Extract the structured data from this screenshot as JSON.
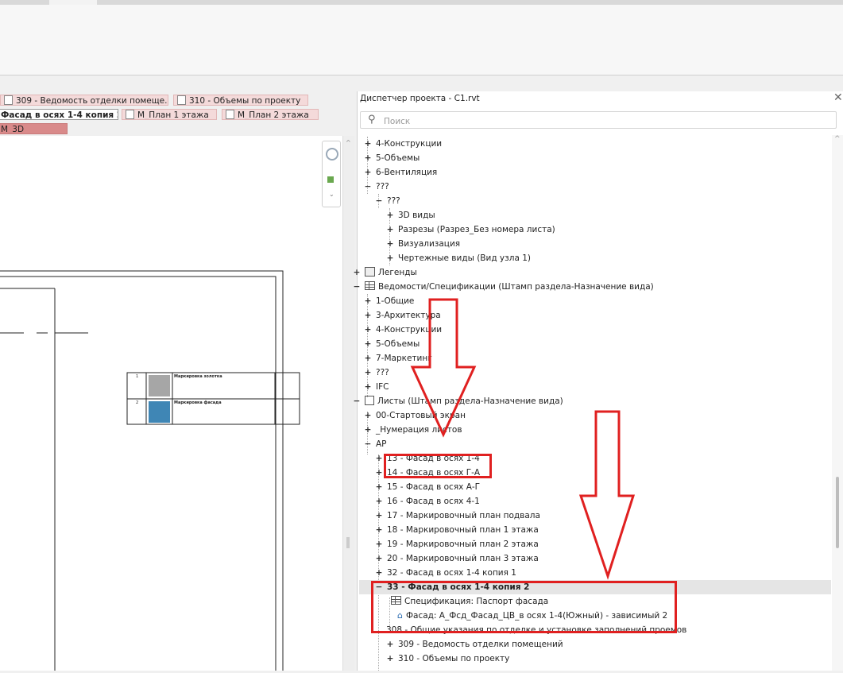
{
  "view_tabs": {
    "row1": [
      "309 - Ведомость отделки помеще...",
      "310 - Объемы по проекту"
    ],
    "row2_active": "Фасад в осях 1-4 копия 2",
    "row2": [
      "М_План 1 этажа",
      "М_План 2 этажа"
    ],
    "row3": "М_3D"
  },
  "canvas": {
    "legend_rows": [
      {
        "num": "1",
        "label": "Маркировка золотка"
      },
      {
        "num": "2",
        "label": "Маркировка фасада"
      }
    ],
    "swatch_colors": [
      "#a6a6a6",
      "#3f86b5"
    ]
  },
  "project_browser": {
    "title": "Диспетчер проекта - С1.rvt",
    "search_placeholder": "Поиск",
    "items": [
      {
        "pm": "+",
        "label": "4-Конструкции"
      },
      {
        "pm": "+",
        "label": "5-Объемы"
      },
      {
        "pm": "+",
        "label": "6-Вентиляция"
      },
      {
        "pm": "−",
        "label": "???"
      },
      {
        "pm": "−",
        "label": "???"
      },
      {
        "pm": "+",
        "label": "3D виды"
      },
      {
        "pm": "+",
        "label": "Разрезы (Разрез_Без номера листа)"
      },
      {
        "pm": "+",
        "label": "Визуализация"
      },
      {
        "pm": "+",
        "label": "Чертежные виды (Вид узла 1)"
      },
      {
        "pm": "+",
        "label": "Легенды"
      },
      {
        "pm": "−",
        "label": "Ведомости/Спецификации (Штамп раздела-Назначение вида)"
      },
      {
        "pm": "+",
        "label": "1-Общие"
      },
      {
        "pm": "+",
        "label": "3-Архитектура"
      },
      {
        "pm": "+",
        "label": "4-Конструкции"
      },
      {
        "pm": "+",
        "label": "5-Объемы"
      },
      {
        "pm": "+",
        "label": "7-Маркетинг"
      },
      {
        "pm": "+",
        "label": "???"
      },
      {
        "pm": "+",
        "label": "IFC"
      },
      {
        "pm": "−",
        "label": "Листы (Штамп раздела-Назначение вида)"
      },
      {
        "pm": "+",
        "label": "00-Стартовый экран"
      },
      {
        "pm": "+",
        "label": "_Нумерация листов"
      },
      {
        "pm": "−",
        "label": "АР"
      },
      {
        "pm": "+",
        "label": "13 - Фасад в осях 1-4"
      },
      {
        "pm": "+",
        "label": "14 - Фасад в осях Г-А"
      },
      {
        "pm": "+",
        "label": "15 - Фасад в осях А-Г"
      },
      {
        "pm": "+",
        "label": "16 - Фасад в осях 4-1"
      },
      {
        "pm": "+",
        "label": "17 - Маркировочный план подвала"
      },
      {
        "pm": "+",
        "label": "18 - Маркировочный план 1 этажа"
      },
      {
        "pm": "+",
        "label": "19 - Маркировочный план 2 этажа"
      },
      {
        "pm": "+",
        "label": "20 - Маркировочный план 3 этажа"
      },
      {
        "pm": "+",
        "label": "32 - Фасад в осях 1-4 копия 1"
      },
      {
        "pm": "−",
        "label": "33 - Фасад в осях 1-4 копия 2"
      },
      {
        "pm": "",
        "label": "Спецификация: Паспорт фасада"
      },
      {
        "pm": "",
        "label": "Фасад: А_Фсд_Фасад_ЦВ_в осях 1-4(Южный) - зависимый 2"
      },
      {
        "pm": "",
        "label": "308 - Общие указания по отделке и установке заполнений проемов"
      },
      {
        "pm": "+",
        "label": "309 - Ведомость отделки помещений"
      },
      {
        "pm": "+",
        "label": "310 - Объемы по проекту"
      }
    ]
  },
  "annotation_color": "#e02020"
}
